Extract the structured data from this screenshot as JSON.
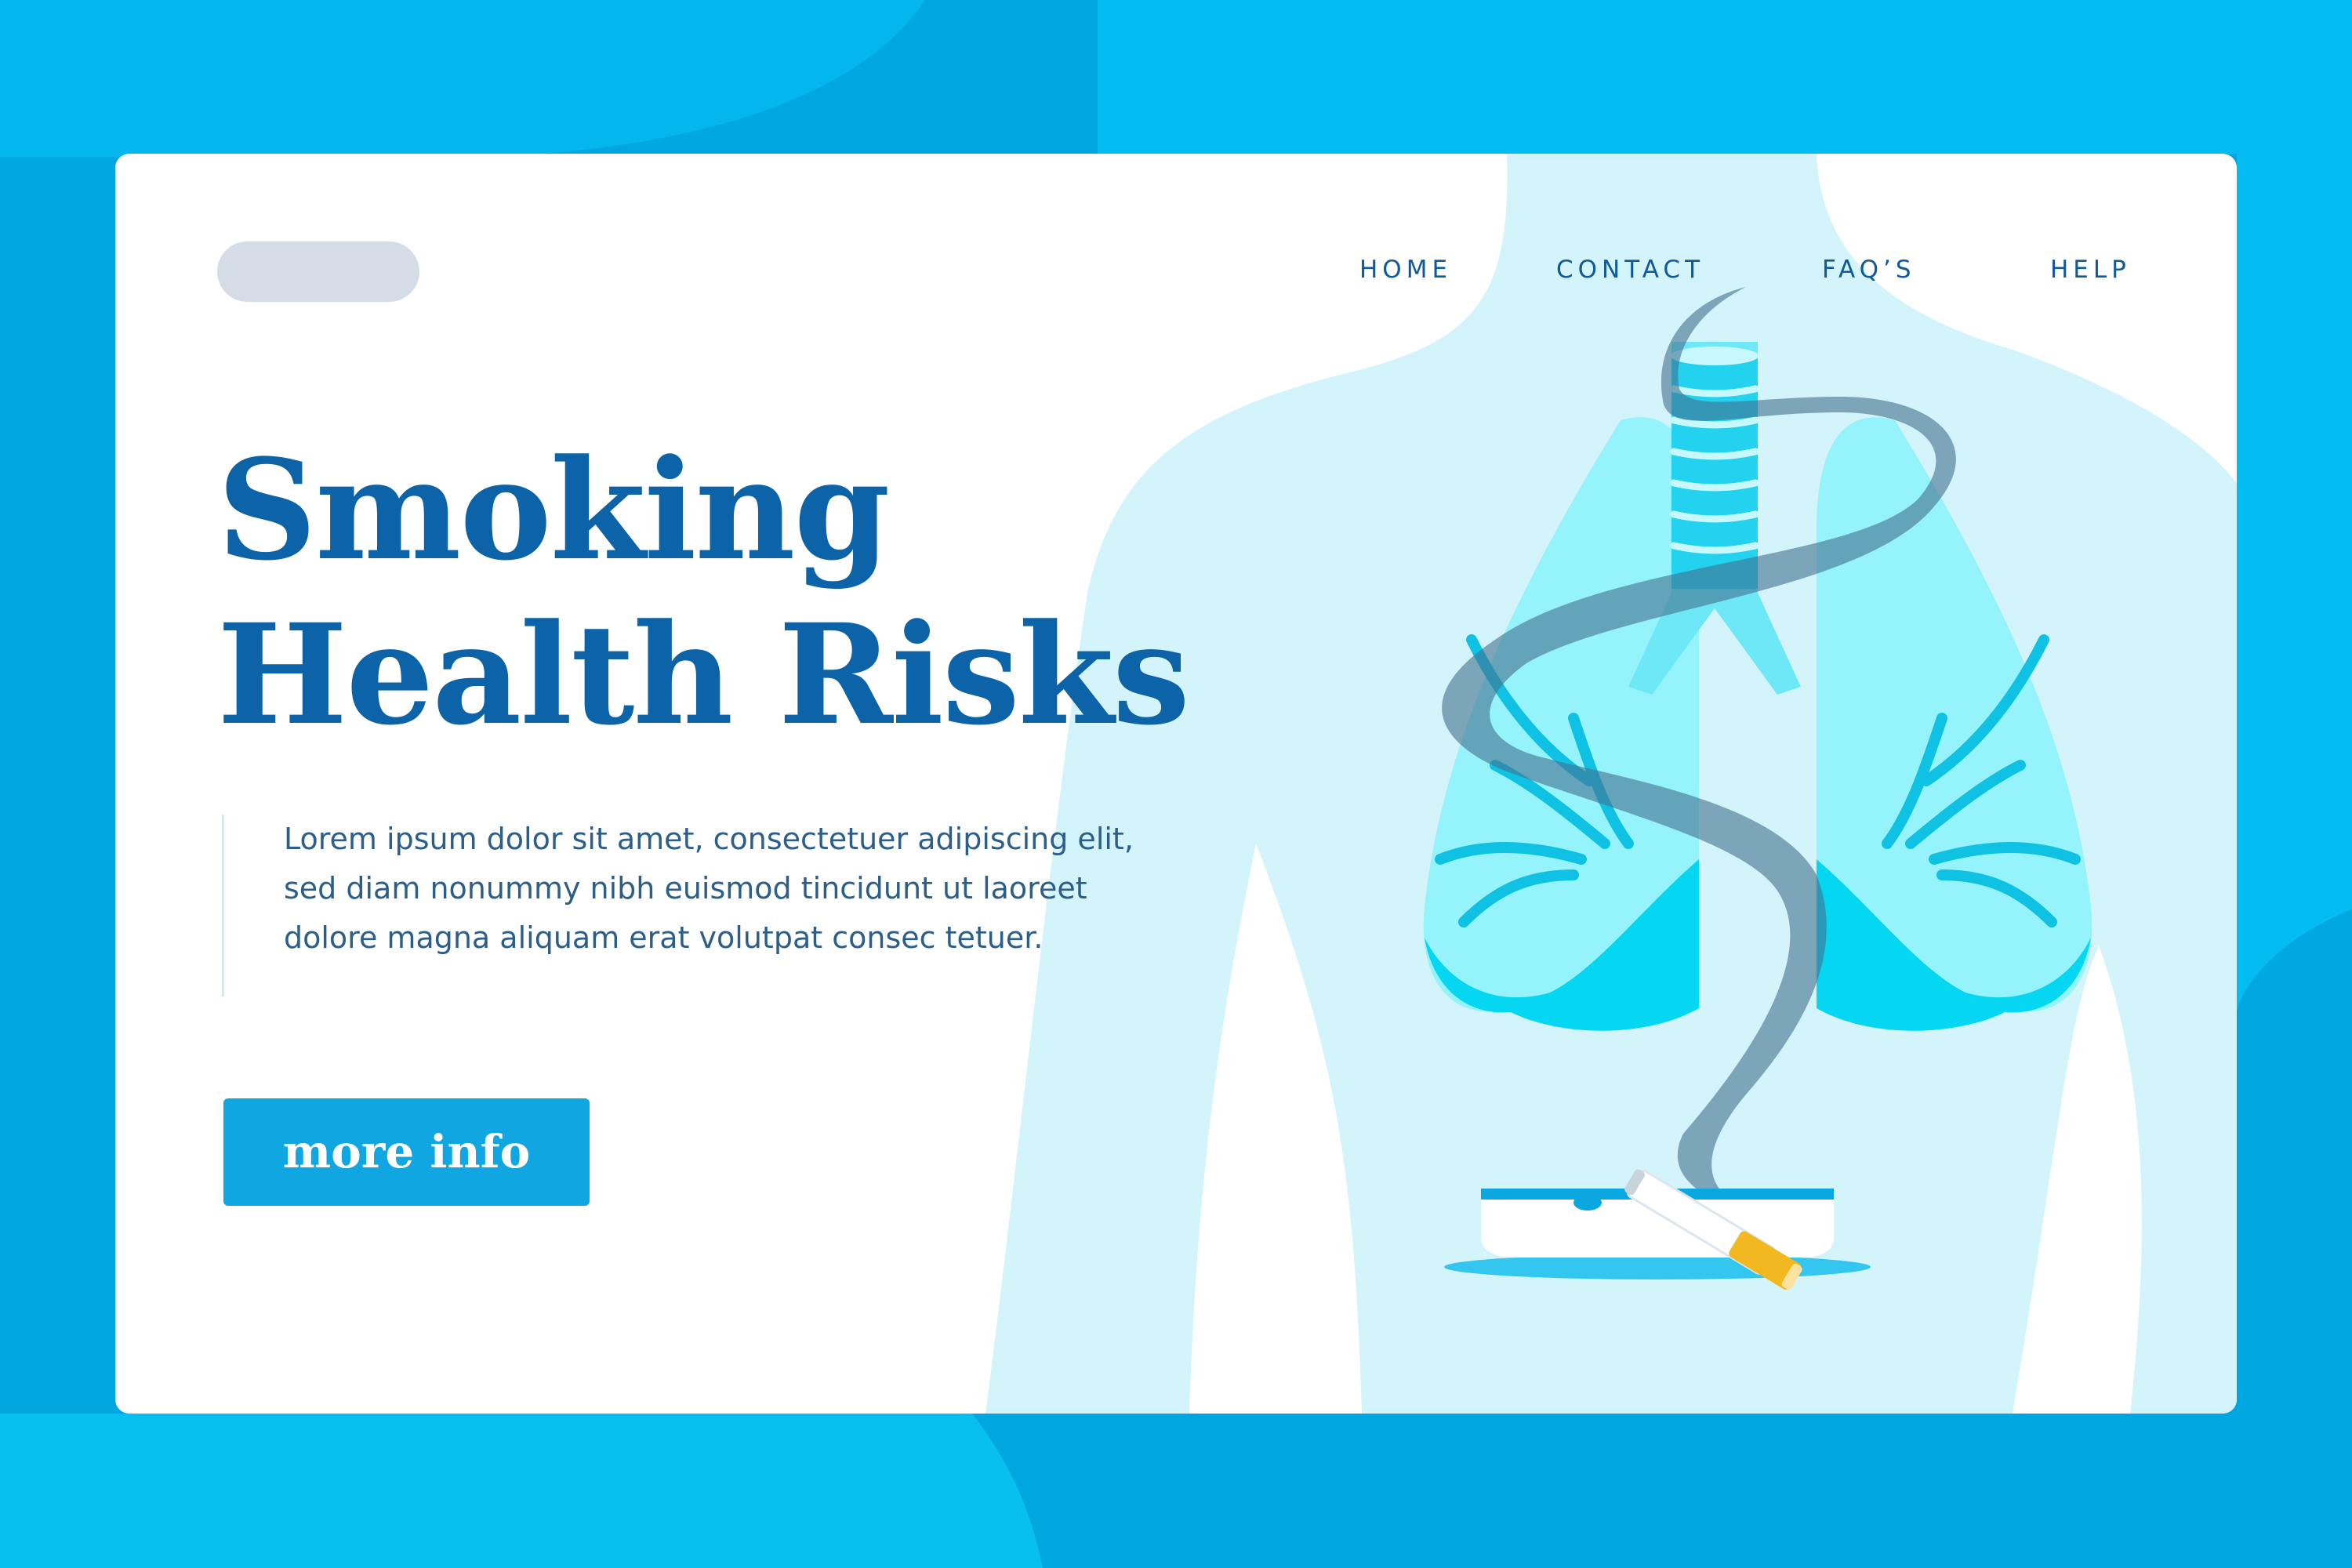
{
  "nav": {
    "items": [
      {
        "label": "HOME"
      },
      {
        "label": "CONTACT"
      },
      {
        "label": "FAQ’S"
      },
      {
        "label": "HELP"
      }
    ]
  },
  "hero": {
    "title_line1": "Smoking",
    "title_line2": "Health Risks",
    "body": "Lorem ipsum dolor sit amet, consectetuer adipiscing elit, sed diam nonummy nibh euismod tincidunt ut laoreet dolore magna aliquam erat volutpat consec tetuer.",
    "cta_label": "more info"
  },
  "illustration": {
    "icons": [
      "torso-silhouette-icon",
      "lungs-icon",
      "trachea-icon",
      "smoke-icon",
      "ashtray-icon",
      "cigarette-icon"
    ]
  },
  "colors": {
    "page_bg": "#00a6df",
    "card_bg": "#ffffff",
    "heading": "#0d63a7",
    "nav_text": "#0f5a9c",
    "button_bg": "#10a6e2",
    "logo_placeholder": "#d4dde6",
    "torso": "#d4f4fb",
    "lungs": "#5fe4f7",
    "smoke": "#5a7d96",
    "cigarette_filter": "#f2b820"
  }
}
